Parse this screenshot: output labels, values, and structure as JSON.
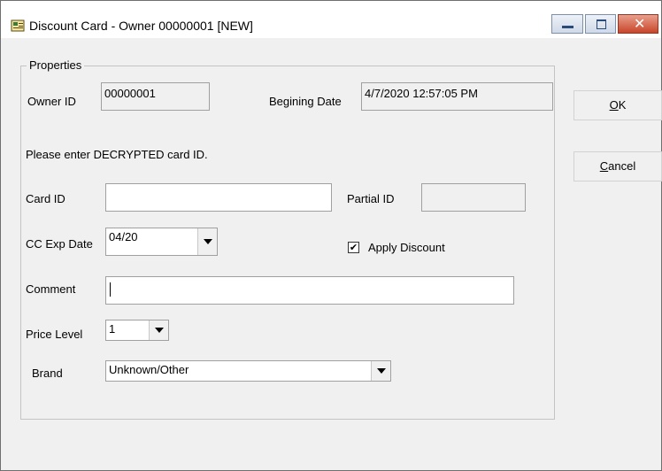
{
  "window": {
    "title": "Discount Card  - Owner 00000001 [NEW]",
    "icon": "document-card-icon"
  },
  "caption_buttons": {
    "minimize": "minimize-icon",
    "maximize": "maximize-icon",
    "close": "close-icon"
  },
  "properties": {
    "legend": "Properties",
    "owner_id_label": "Owner ID",
    "owner_id_value": "00000001",
    "begin_date_label": "Begining Date",
    "begin_date_value": "4/7/2020 12:57:05 PM",
    "instruction": "Please enter DECRYPTED card ID.",
    "card_id_label": "Card ID",
    "card_id_value": "",
    "partial_id_label": "Partial ID",
    "partial_id_value": "",
    "cc_exp_label": "CC Exp Date",
    "cc_exp_value": "04/20",
    "apply_discount_label": "Apply Discount",
    "apply_discount_checked": true,
    "comment_label": "Comment",
    "comment_value": "",
    "price_level_label": "Price Level",
    "price_level_value": "1",
    "brand_label": "Brand",
    "brand_value": "Unknown/Other"
  },
  "buttons": {
    "ok_mnemonic": "O",
    "ok_rest": "K",
    "cancel_mnemonic": "C",
    "cancel_rest": "ancel"
  }
}
